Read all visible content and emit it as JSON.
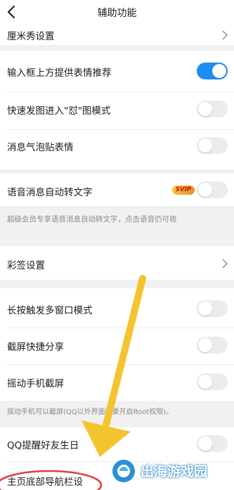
{
  "header": {
    "title": "辅助功能",
    "back_icon": "back-arrow-icon"
  },
  "rows": {
    "cmshow": "厘米秀设置",
    "emoji_suggest": "输入框上方提供表情推荐",
    "quick_meme": "快速发图进入\"怼\"图模式",
    "bubble_sticker": "消息气泡贴表情",
    "voice_to_text": "语音消息自动转文字",
    "svip_badge": "SVIP",
    "voice_note": "超级会员专享语音消息自动转文字，点击语音仍可收",
    "color_sign": "彩签设置",
    "long_press_multi": "长按触发多窗口模式",
    "screenshot_share": "截屏快捷分享",
    "shake_screenshot": "摇动手机截屏",
    "shake_note": "摇动手机可以截屏(QQ以外界面需要开启Root权限)。",
    "birthday_remind": "QQ提醒好友生日",
    "bottom_nav": "主页底部导航栏设"
  },
  "toggles": {
    "emoji_suggest": true,
    "quick_meme": false,
    "bubble_sticker": false,
    "voice_to_text": false,
    "long_press_multi": false,
    "screenshot_share": false,
    "shake_screenshot": false,
    "birthday_remind": false
  },
  "watermark": {
    "text": "出海游戏园"
  },
  "colors": {
    "accent": "#1f8cf0",
    "annotation_arrow": "#f4c430",
    "annotation_circle": "#e0413c"
  }
}
